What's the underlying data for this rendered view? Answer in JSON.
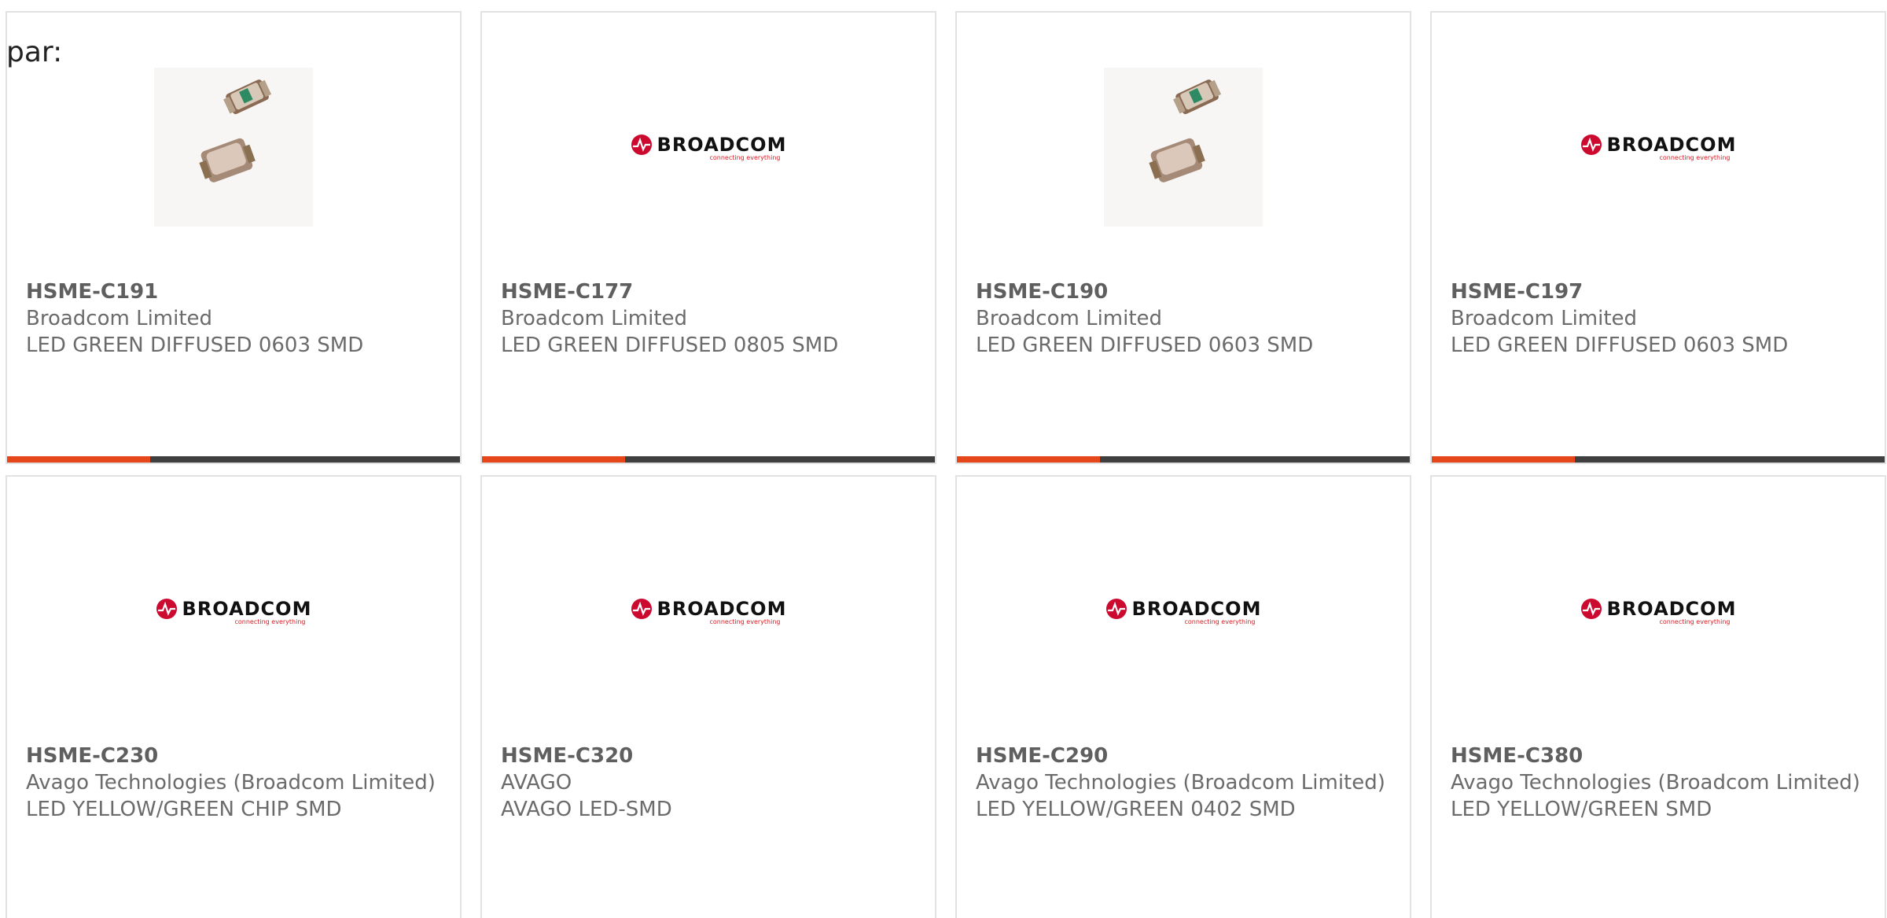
{
  "header": {
    "label": "par:"
  },
  "brand": {
    "logo_word": "BROADCOM",
    "logo_tagline": "connecting everything",
    "accent_color": "#e5471a",
    "bar_color": "#3f3f3f"
  },
  "cards": [
    {
      "part": "HSME-C191",
      "manufacturer": "Broadcom Limited",
      "description": "LED GREEN DIFFUSED 0603 SMD",
      "image": "led-chip-photo"
    },
    {
      "part": "HSME-C177",
      "manufacturer": "Broadcom Limited",
      "description": "LED GREEN DIFFUSED 0805 SMD",
      "image": "broadcom-logo"
    },
    {
      "part": "HSME-C190",
      "manufacturer": "Broadcom Limited",
      "description": "LED GREEN DIFFUSED 0603 SMD",
      "image": "led-chip-photo"
    },
    {
      "part": "HSME-C197",
      "manufacturer": "Broadcom Limited",
      "description": "LED GREEN DIFFUSED 0603 SMD",
      "image": "broadcom-logo"
    },
    {
      "part": "HSME-C230",
      "manufacturer": "Avago Technologies (Broadcom Limited)",
      "description": "LED YELLOW/GREEN CHIP SMD",
      "image": "broadcom-logo"
    },
    {
      "part": "HSME-C320",
      "manufacturer": "AVAGO",
      "description": "AVAGO LED-SMD",
      "image": "broadcom-logo"
    },
    {
      "part": "HSME-C290",
      "manufacturer": "Avago Technologies (Broadcom Limited)",
      "description": "LED YELLOW/GREEN 0402 SMD",
      "image": "broadcom-logo"
    },
    {
      "part": "HSME-C380",
      "manufacturer": "Avago Technologies (Broadcom Limited)",
      "description": "LED YELLOW/GREEN SMD",
      "image": "broadcom-logo"
    }
  ]
}
